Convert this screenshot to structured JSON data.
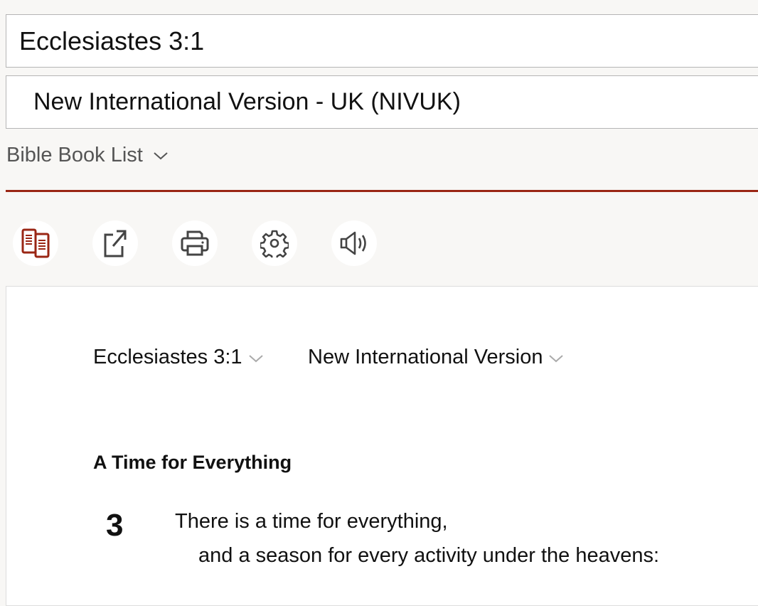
{
  "search": {
    "passage": "Ecclesiastes 3:1",
    "version": "New International Version - UK (NIVUK)"
  },
  "book_list_label": "Bible Book List",
  "toolbar": [
    {
      "icon": "parallel-icon",
      "label": "Parallel"
    },
    {
      "icon": "share-icon",
      "label": "Share"
    },
    {
      "icon": "print-icon",
      "label": "Print"
    },
    {
      "icon": "gear-icon",
      "label": "Settings"
    },
    {
      "icon": "speaker-icon",
      "label": "Audio"
    }
  ],
  "accent": "#9a2614",
  "passage": {
    "reference": "Ecclesiastes 3:1",
    "version": "New International Version",
    "heading": "A Time for Everything",
    "chapter": "3",
    "lines": [
      "There is a time for everything,",
      "and a season for every activity under the heavens:"
    ]
  }
}
